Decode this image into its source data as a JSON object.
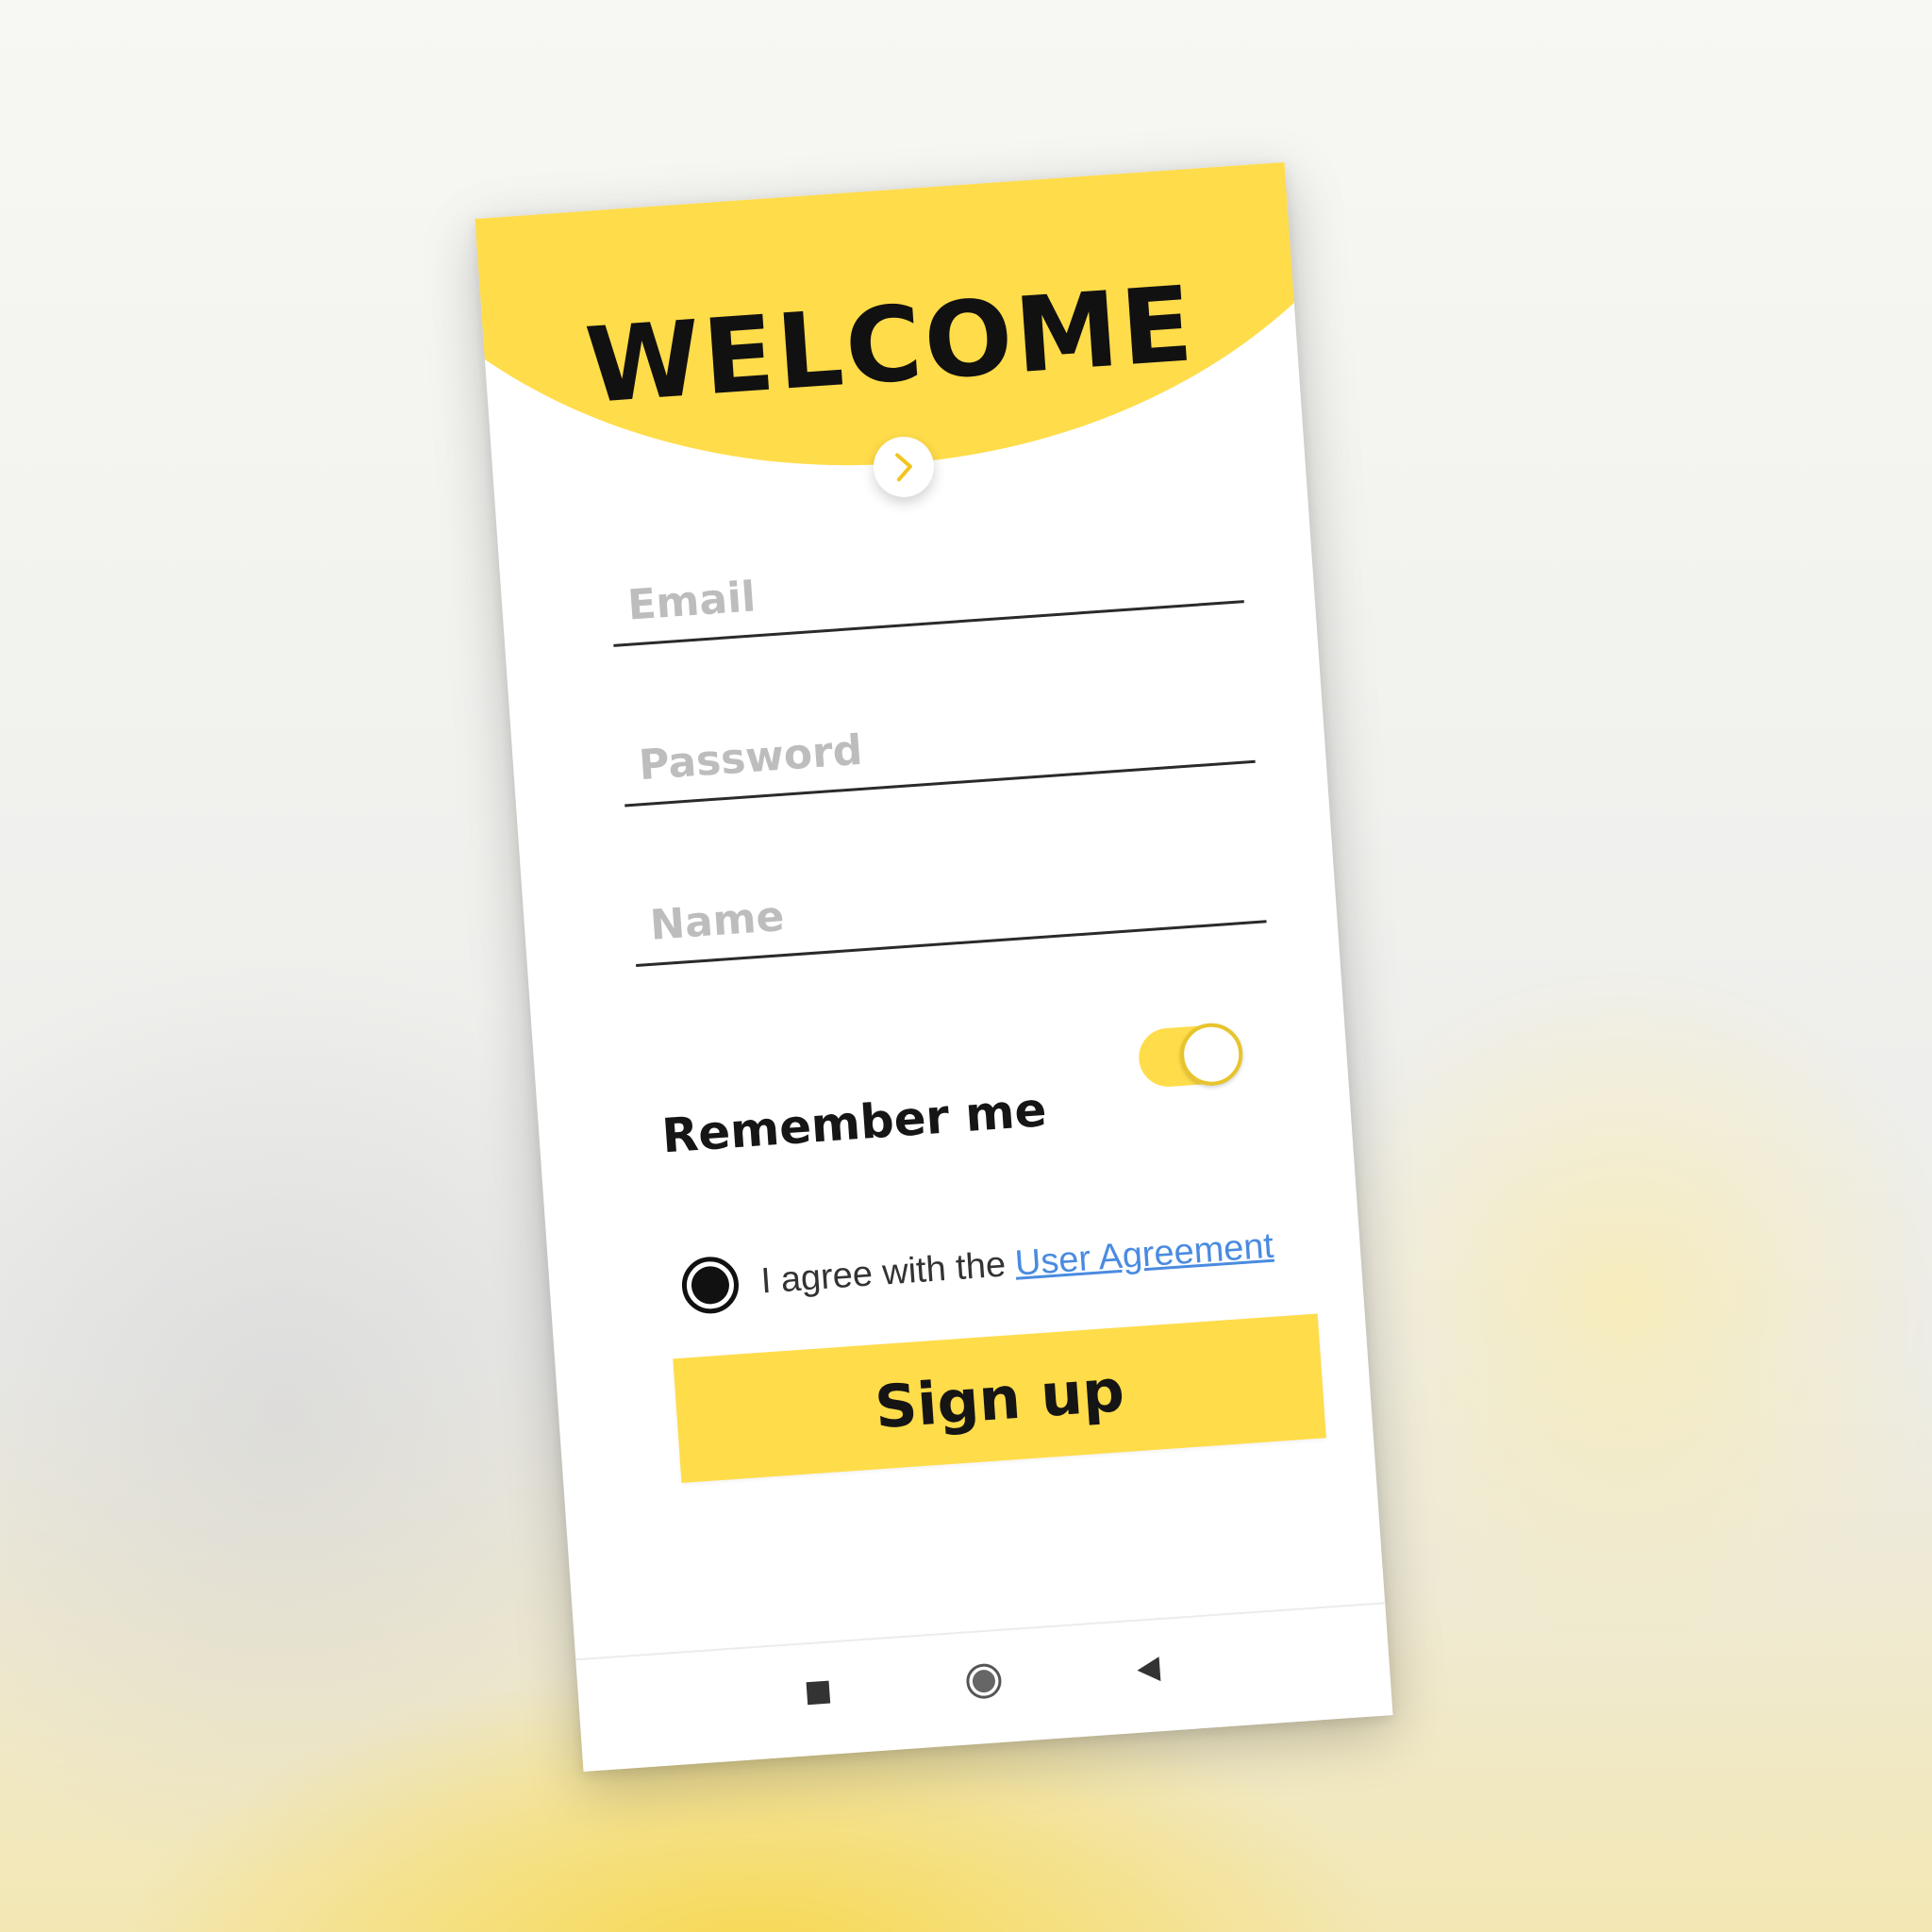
{
  "header": {
    "title": "WELCOME",
    "accent_color": "#ffdc4a",
    "next_icon": "chevron-right-icon"
  },
  "form": {
    "email": {
      "placeholder": "Email",
      "value": ""
    },
    "password": {
      "placeholder": "Password",
      "value": ""
    },
    "name": {
      "placeholder": "Name",
      "value": ""
    }
  },
  "remember": {
    "label": "Remember me",
    "enabled": true
  },
  "agreement": {
    "checked": true,
    "text": "I agree with the",
    "link_text": "User Agreement",
    "link_color": "#4a8be0"
  },
  "signup": {
    "label": "Sign up"
  },
  "nav_bar": {
    "recent_icon": "square-icon",
    "home_icon": "circle-icon",
    "back_icon": "triangle-back-icon"
  }
}
